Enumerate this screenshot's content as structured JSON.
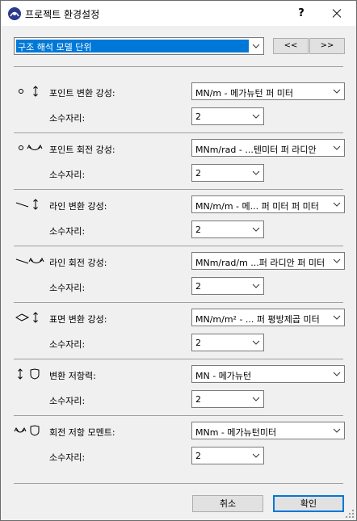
{
  "window": {
    "title": "프로젝트 환경설정",
    "help": "?"
  },
  "top": {
    "selector_value": "구조 해석 모델 단위",
    "prev_label": "<<",
    "next_label": ">>"
  },
  "rows": [
    {
      "label": "포인트 변환 강성:",
      "unit": "MN/m - 메가뉴턴 퍼 미터",
      "decimals_label": "소수자리:",
      "decimals": "2"
    },
    {
      "label": "포인트 회전 강성:",
      "unit": "MNm/rad - ...텐미터 퍼 라디안",
      "decimals_label": "소수자리:",
      "decimals": "2"
    },
    {
      "label": "라인 변환 강성:",
      "unit": "MN/m/m - 메... 퍼 미터 퍼 미터",
      "decimals_label": "소수자리:",
      "decimals": "2"
    },
    {
      "label": "라인 회전 강성:",
      "unit": "MNm/rad/m ...퍼 라디안 퍼 미터",
      "decimals_label": "소수자리:",
      "decimals": "2"
    },
    {
      "label": "표면 변환 강성:",
      "unit": "MN/m/m² - ... 퍼 평방제곱 미터",
      "decimals_label": "소수자리:",
      "decimals": "2"
    },
    {
      "label": "변환 저항력:",
      "unit": "MN - 메가뉴턴",
      "decimals_label": "소수자리:",
      "decimals": "2"
    },
    {
      "label": "회전 저항 모멘트:",
      "unit": "MNm - 메가뉴턴미터",
      "decimals_label": "소수자리:",
      "decimals": "2"
    }
  ],
  "footer": {
    "cancel_label": "취소",
    "ok_label": "확인"
  },
  "colors": {
    "selection": "#0078d7",
    "window_bg": "#f0f0f0"
  }
}
